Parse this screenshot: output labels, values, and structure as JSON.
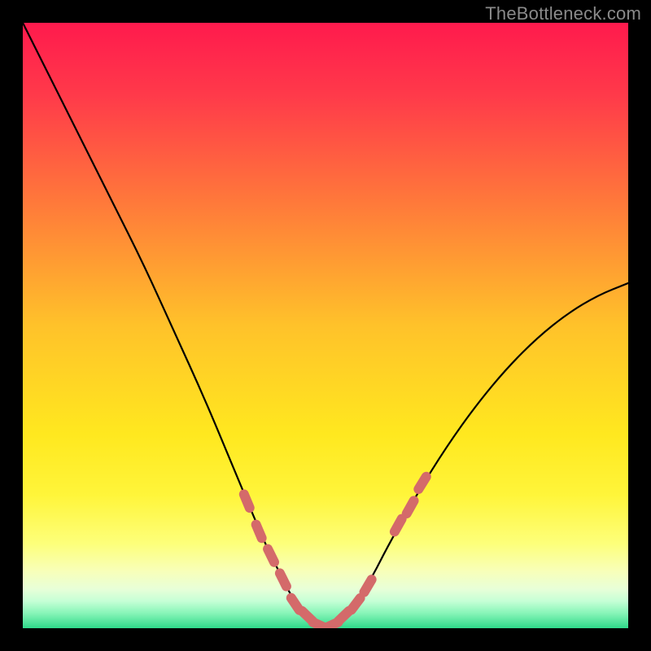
{
  "watermark": "TheBottleneck.com",
  "chart_data": {
    "type": "line",
    "title": "",
    "xlabel": "",
    "ylabel": "",
    "xlim": [
      0,
      100
    ],
    "ylim": [
      0,
      100
    ],
    "series": [
      {
        "name": "curve",
        "x": [
          0,
          5,
          10,
          15,
          20,
          25,
          30,
          35,
          40,
          42,
          45,
          48,
          50,
          52,
          55,
          58,
          60,
          65,
          70,
          75,
          80,
          85,
          90,
          95,
          100
        ],
        "y": [
          100,
          90,
          80,
          70,
          60,
          49,
          38,
          26,
          14,
          10,
          4,
          1,
          0,
          1,
          4,
          9,
          13,
          22,
          30,
          37,
          43,
          48,
          52,
          55,
          57
        ]
      }
    ],
    "markers": {
      "name": "highlight-points",
      "color": "#d46a6a",
      "x": [
        37,
        39,
        41,
        43,
        45,
        47,
        49,
        51,
        53,
        55,
        57,
        62,
        64,
        66
      ],
      "y": [
        21,
        16,
        12,
        8,
        4,
        2,
        0.5,
        0.5,
        2,
        4,
        7,
        17,
        20,
        24
      ]
    },
    "background_gradient": {
      "type": "vertical",
      "stops": [
        {
          "offset": 0.0,
          "color": "#ff1a4d"
        },
        {
          "offset": 0.12,
          "color": "#ff3a4a"
        },
        {
          "offset": 0.3,
          "color": "#ff7a3a"
        },
        {
          "offset": 0.5,
          "color": "#ffc22a"
        },
        {
          "offset": 0.68,
          "color": "#ffe81f"
        },
        {
          "offset": 0.78,
          "color": "#fff53a"
        },
        {
          "offset": 0.86,
          "color": "#fdff7a"
        },
        {
          "offset": 0.905,
          "color": "#f8ffb8"
        },
        {
          "offset": 0.935,
          "color": "#e8ffd8"
        },
        {
          "offset": 0.955,
          "color": "#c6ffd6"
        },
        {
          "offset": 0.975,
          "color": "#88f5b8"
        },
        {
          "offset": 1.0,
          "color": "#2fd98a"
        }
      ]
    }
  }
}
